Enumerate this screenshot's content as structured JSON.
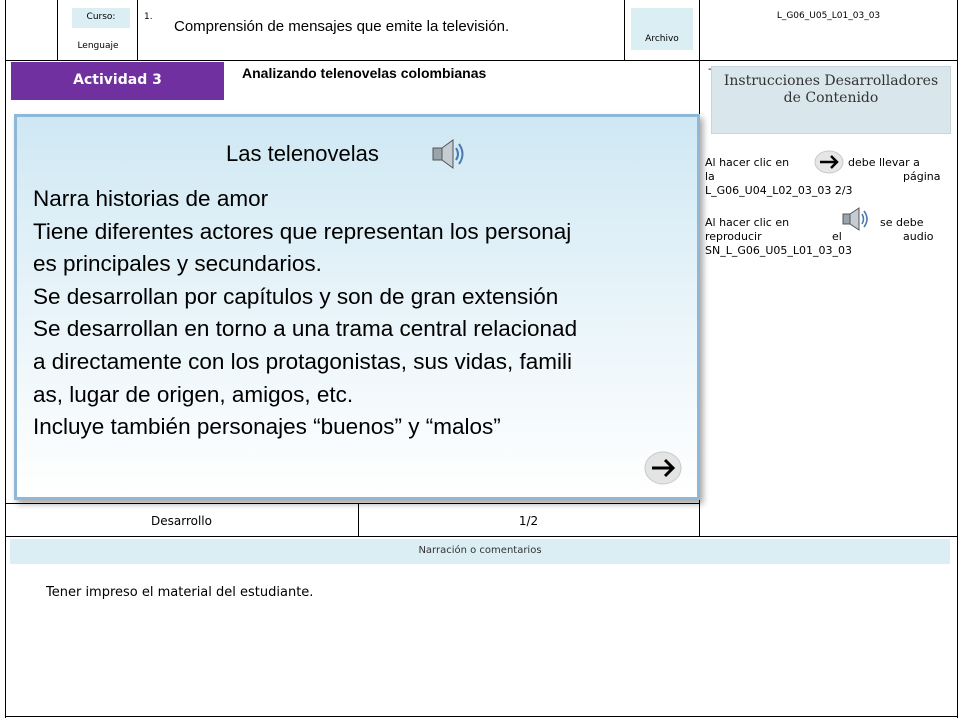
{
  "header": {
    "curso_label": "Curso:",
    "subject": "Lenguaje",
    "number": "1.",
    "title": "Comprensión de mensajes que emite la televisión.",
    "archivo_label": "Archivo",
    "code": "L_G06_U05_L01_03_03"
  },
  "activity": {
    "badge": "Actividad 3",
    "subtitle": "Analizando telenovelas colombianas"
  },
  "panel": {
    "heading": "Las telenovelas",
    "lines": [
      "Narra historias de amor",
      "Tiene  diferentes actores que representan los personaj",
      "es principales y secundarios.",
      "Se desarrollan por capítulos y son de gran extensión",
      "Se desarrollan en torno a una trama central relacionad",
      "a directamente con los protagonistas, sus vidas, famili",
      "as, lugar de origen, amigos, etc.",
      "Incluye también personajes “buenos” y “malos”"
    ]
  },
  "footer_row": {
    "stage": "Desarrollo",
    "page": "1/2"
  },
  "instructions": {
    "title": "Instrucciones Desarrolladores de Contenido",
    "dash": "-",
    "rule1_a": "Al hacer clic en",
    "rule1_b": "debe llevar a",
    "rule1_c": "la",
    "rule1_d": "página",
    "rule1_e": "L_G06_U04_L02_03_03 2/3",
    "rule2_a": "Al hacer clic en",
    "rule2_b": "se debe",
    "rule2_c": "reproducir",
    "rule2_d": "el",
    "rule2_e": "audio",
    "rule2_f": "SN_L_G06_U05_L01_03_03"
  },
  "narration": {
    "label": "Narración o comentarios",
    "text": "Tener impreso el material del estudiante."
  },
  "colors": {
    "badge_purple": "#7030a0",
    "header_cyan": "#daeef3",
    "panel_border": "#8fb8d8"
  }
}
